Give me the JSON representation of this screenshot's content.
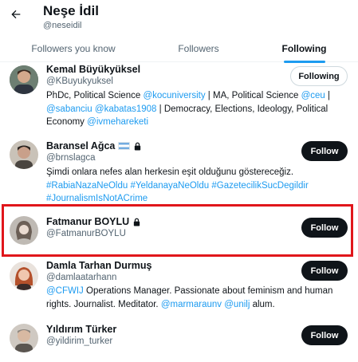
{
  "header": {
    "name": "Neşe İdil",
    "handle": "@neseidil"
  },
  "tabs": [
    {
      "label": "Followers you know"
    },
    {
      "label": "Followers"
    },
    {
      "label": "Following"
    }
  ],
  "users": [
    {
      "name": "Kemal Büyükyüksel",
      "handle": "@KBuyukyuksel",
      "button": "Following",
      "bio_line1": {
        "t1": "PhDc, Political Science ",
        "m1": "@kocuniversity",
        "t2": " | MA, Political Science ",
        "m2": "@ceu",
        "t3": " |"
      },
      "bio_line2": {
        "m1": "@sabanciu",
        "t1": " ",
        "m2": "@kabatas1908",
        "t2": " | Democracy, Elections, Ideology, Political"
      },
      "bio_line3": {
        "t1": "Economy ",
        "m1": "@ivmehareketi"
      }
    },
    {
      "name": "Baransel Ağca",
      "handle": "@brnslagca",
      "button": "Follow",
      "bio_line1": "Şimdi onlara nefes alan herkesin eşit olduğunu göstereceğiz.",
      "bio_line2": "#RabiaNazaNeOldu #YeldanayaNeOldu #GazetecilikSucDegildir",
      "bio_line3": "#JournalismIsNotACrime"
    },
    {
      "name": "Fatmanur BOYLU",
      "handle": "@FatmanurBOYLU",
      "button": "Follow"
    },
    {
      "name": "Damla Tarhan Durmuş",
      "handle": "@damlaatarhann",
      "button": "Follow",
      "bio_line1": {
        "m1": "@CFWIJ",
        "t1": " Operations Manager. Passionate about feminism and human"
      },
      "bio_line2": {
        "t1": "rights. Journalist. Meditator. ",
        "m1": "@marmaraunv",
        "t2": " ",
        "m2": "@unilj",
        "t3": " alum."
      }
    },
    {
      "name": "Yıldırım Türker",
      "handle": "@yildirim_turker",
      "button": "Follow"
    }
  ],
  "colors": {
    "accent": "#1d9bf0",
    "highlight": "#e0161b",
    "text": "#0f1419",
    "muted": "#536471"
  }
}
